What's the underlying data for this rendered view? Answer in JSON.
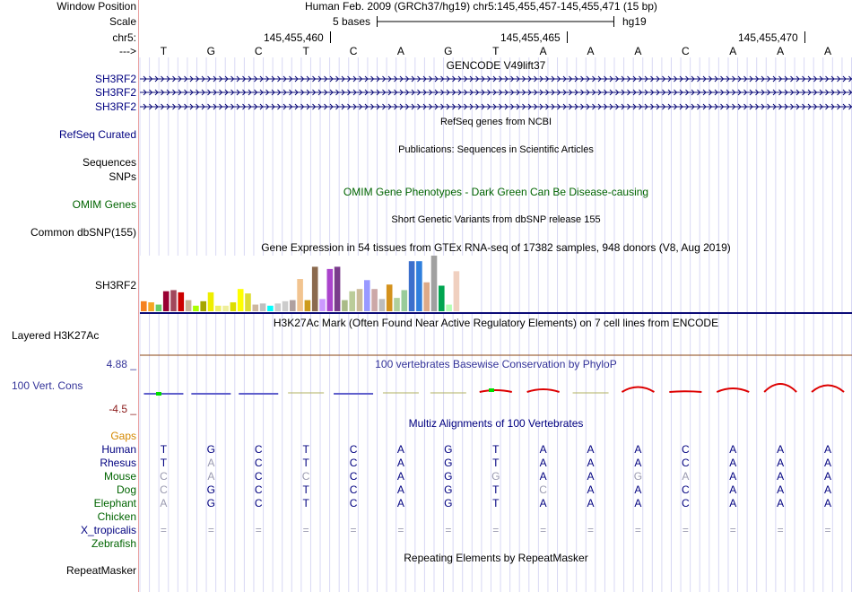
{
  "ruler": {
    "window_position_label": "Window Position",
    "assembly_text": "Human Feb. 2009 (GRCh37/hg19)   chr5:145,455,457-145,455,471 (15 bp)",
    "scale_label": "Scale",
    "scale_text": "5 bases",
    "scale_db": "hg19",
    "chrom_label": "chr5:",
    "ticks": [
      "145,455,460",
      "145,455,465",
      "145,455,470"
    ],
    "arrow_label": "--->",
    "bases": [
      "T",
      "G",
      "C",
      "T",
      "C",
      "A",
      "G",
      "T",
      "A",
      "A",
      "A",
      "C",
      "A",
      "A",
      "A"
    ]
  },
  "tracks": {
    "gencode": {
      "title": "GENCODE V49lift37",
      "rows": [
        "SH3RF2",
        "SH3RF2",
        "SH3RF2"
      ]
    },
    "refseq": {
      "title": "RefSeq genes from NCBI",
      "label": "RefSeq Curated"
    },
    "publications": {
      "title": "Publications: Sequences in Scientific Articles",
      "label_1": "Sequences",
      "label_2": "SNPs"
    },
    "omim": {
      "title": "OMIM Gene Phenotypes - Dark Green Can Be Disease-causing",
      "label": "OMIM Genes"
    },
    "dbsnp": {
      "title": "Short Genetic Variants from dbSNP release 155",
      "label": "Common dbSNP(155)"
    },
    "gtex": {
      "title": "Gene Expression in 54 tissues from GTEx RNA-seq of 17382 samples, 948 donors (V8, Aug 2019)",
      "label": "SH3RF2",
      "bars": [
        {
          "v": 0.18,
          "c": "#f58220"
        },
        {
          "v": 0.16,
          "c": "#f5a623"
        },
        {
          "v": 0.12,
          "c": "#66cc66"
        },
        {
          "v": 0.36,
          "c": "#990033"
        },
        {
          "v": 0.38,
          "c": "#a1475b"
        },
        {
          "v": 0.34,
          "c": "#cc0000"
        },
        {
          "v": 0.2,
          "c": "#c8b496"
        },
        {
          "v": 0.1,
          "c": "#aaff00"
        },
        {
          "v": 0.18,
          "c": "#a6a600"
        },
        {
          "v": 0.34,
          "c": "#eeee00"
        },
        {
          "v": 0.1,
          "c": "#eeee66"
        },
        {
          "v": 0.1,
          "c": "#eeee99"
        },
        {
          "v": 0.16,
          "c": "#dddd00"
        },
        {
          "v": 0.4,
          "c": "#ffff00"
        },
        {
          "v": 0.32,
          "c": "#dddd33"
        },
        {
          "v": 0.12,
          "c": "#cdb79e"
        },
        {
          "v": 0.14,
          "c": "#c0c0c0"
        },
        {
          "v": 0.1,
          "c": "#00ffff"
        },
        {
          "v": 0.14,
          "c": "#cccccc"
        },
        {
          "v": 0.18,
          "c": "#cccccc"
        },
        {
          "v": 0.2,
          "c": "#b0a0a0"
        },
        {
          "v": 0.58,
          "c": "#f2c490"
        },
        {
          "v": 0.2,
          "c": "#cd9b1d"
        },
        {
          "v": 0.8,
          "c": "#8b6a4e"
        },
        {
          "v": 0.22,
          "c": "#cc99ff"
        },
        {
          "v": 0.76,
          "c": "#aa44cc"
        },
        {
          "v": 0.8,
          "c": "#7a3c8c"
        },
        {
          "v": 0.2,
          "c": "#aabb88"
        },
        {
          "v": 0.36,
          "c": "#bbcc99"
        },
        {
          "v": 0.4,
          "c": "#ccbb99"
        },
        {
          "v": 0.56,
          "c": "#9999ff"
        },
        {
          "v": 0.4,
          "c": "#cca8a8"
        },
        {
          "v": 0.22,
          "c": "#bcbcbc"
        },
        {
          "v": 0.48,
          "c": "#d4921d"
        },
        {
          "v": 0.24,
          "c": "#b0d09c"
        },
        {
          "v": 0.38,
          "c": "#99cc99"
        },
        {
          "v": 0.9,
          "c": "#3b6fcc"
        },
        {
          "v": 0.9,
          "c": "#2f7fdd"
        },
        {
          "v": 0.52,
          "c": "#ddaa88"
        },
        {
          "v": 1.0,
          "c": "#a0a0a0"
        },
        {
          "v": 0.46,
          "c": "#00a550"
        },
        {
          "v": 0.12,
          "c": "#b3ffb3"
        },
        {
          "v": 0.72,
          "c": "#f0d0c0"
        }
      ]
    },
    "h3k27ac": {
      "title": "H3K27Ac Mark (Often Found Near Active Regulatory Elements) on 7 cell lines from ENCODE",
      "label": "Layered H3K27Ac"
    },
    "phylop": {
      "title": "100 vertebrates Basewise Conservation by PhyloP",
      "label": "100 Vert. Cons",
      "ymax": "4.88 _",
      "ymin": "-4.5 _",
      "values": [
        -1.2,
        -0.8,
        -0.4,
        0,
        -0.3,
        0,
        0,
        0.8,
        1.2,
        0,
        2.2,
        0.3,
        1.6,
        3.6,
        3.0
      ]
    },
    "multiz": {
      "title": "Multiz Alignments of 100 Vertebrates",
      "gaps_label": "Gaps",
      "species": [
        {
          "name": "Human",
          "seq": [
            "T",
            "G",
            "C",
            "T",
            "C",
            "A",
            "G",
            "T",
            "A",
            "A",
            "A",
            "C",
            "A",
            "A",
            "A"
          ],
          "faded": []
        },
        {
          "name": "Rhesus",
          "seq": [
            "T",
            "A",
            "C",
            "T",
            "C",
            "A",
            "G",
            "T",
            "A",
            "A",
            "A",
            "C",
            "A",
            "A",
            "A"
          ],
          "faded": [
            1
          ]
        },
        {
          "name": "Mouse",
          "seq": [
            "C",
            "A",
            "C",
            "C",
            "C",
            "A",
            "G",
            "G",
            "A",
            "A",
            "G",
            "A",
            "A",
            "A",
            "A"
          ],
          "faded": [
            0,
            1,
            3,
            7,
            10,
            11
          ]
        },
        {
          "name": "Dog",
          "seq": [
            "C",
            "G",
            "C",
            "T",
            "C",
            "A",
            "G",
            "T",
            "C",
            "A",
            "A",
            "C",
            "A",
            "A",
            "A"
          ],
          "faded": [
            0,
            8
          ]
        },
        {
          "name": "Elephant",
          "seq": [
            "A",
            "G",
            "C",
            "T",
            "C",
            "A",
            "G",
            "T",
            "A",
            "A",
            "A",
            "C",
            "A",
            "A",
            "A"
          ],
          "faded": [
            0
          ]
        },
        {
          "name": "Chicken",
          "seq": [],
          "faded": []
        },
        {
          "name": "X_tropicalis",
          "seq": [
            "=",
            "=",
            "=",
            "=",
            "=",
            "=",
            "=",
            "=",
            "=",
            "=",
            "=",
            "=",
            "=",
            "=",
            "="
          ],
          "faded": [
            0,
            1,
            2,
            3,
            4,
            5,
            6,
            7,
            8,
            9,
            10,
            11,
            12,
            13,
            14
          ]
        },
        {
          "name": "Zebrafish",
          "seq": [],
          "faded": []
        }
      ]
    },
    "repeatmasker": {
      "title": "Repeating Elements by RepeatMasker",
      "label": "RepeatMasker"
    }
  },
  "colors": {
    "navy": "#000080",
    "dark_green": "#006400",
    "gaps_orange": "#d48800",
    "grid_blue": "#c8c8ff",
    "phylop_pos": "#dd0000"
  }
}
